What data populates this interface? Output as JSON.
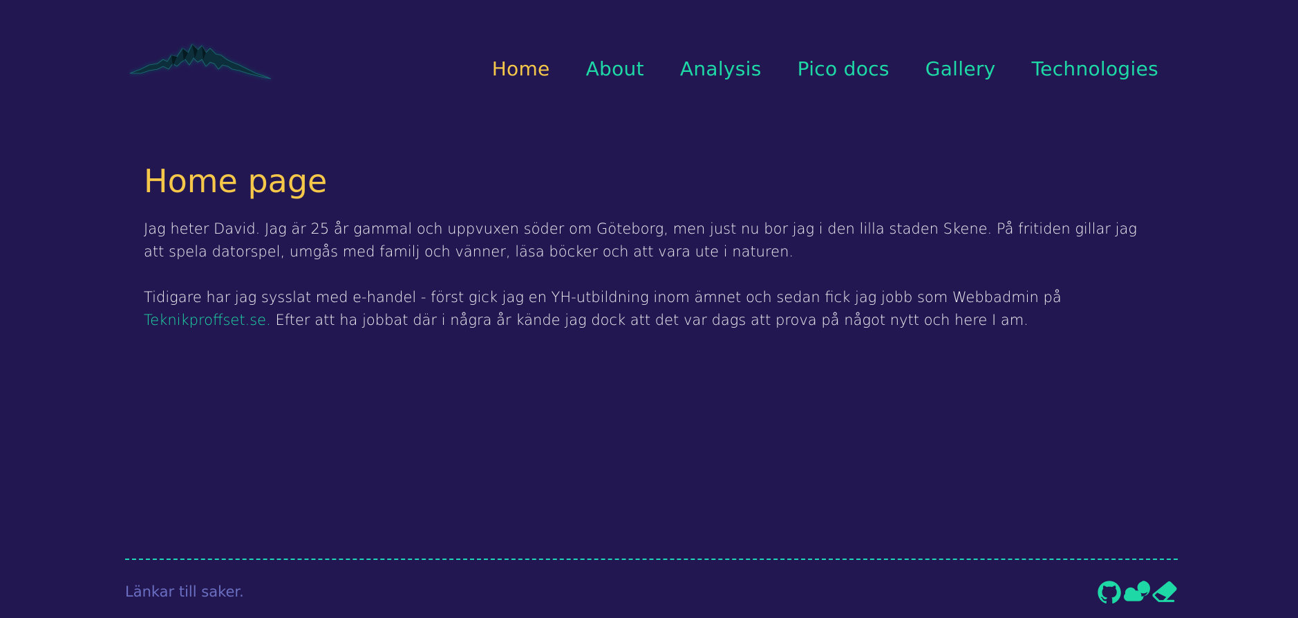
{
  "header": {
    "logo_icon": "mountain-logo",
    "nav": [
      {
        "label": "Home",
        "active": true
      },
      {
        "label": "About",
        "active": false
      },
      {
        "label": "Analysis",
        "active": false
      },
      {
        "label": "Pico docs",
        "active": false
      },
      {
        "label": "Gallery",
        "active": false
      },
      {
        "label": "Technologies",
        "active": false
      }
    ]
  },
  "main": {
    "title": "Home page",
    "paragraph1": "Jag heter David. Jag är 25 år gammal och uppvuxen söder om Göteborg, men just nu bor jag i den lilla staden Skene. På fritiden gillar jag att spela datorspel, umgås med familj och vänner, läsa böcker och att vara ute i naturen.",
    "paragraph2_before": "Tidigare har jag sysslat med e-handel - först gick jag en YH-utbildning inom ämnet och sedan fick jag jobb som Webbadmin på ",
    "paragraph2_link": "Teknikproffset.se.",
    "paragraph2_after": " Efter att ha jobbat där i några år kände jag dock att det var dags att prova på något nytt och here I am."
  },
  "footer": {
    "text": "Länkar till saker.",
    "icons": [
      "github-icon",
      "cloud-moon-icon",
      "eraser-icon"
    ]
  },
  "colors": {
    "background": "#231751",
    "accent": "#1ed8a6",
    "highlight": "#f5c84a",
    "text": "#f1f1f4",
    "footer_text": "#6a6fc2"
  }
}
